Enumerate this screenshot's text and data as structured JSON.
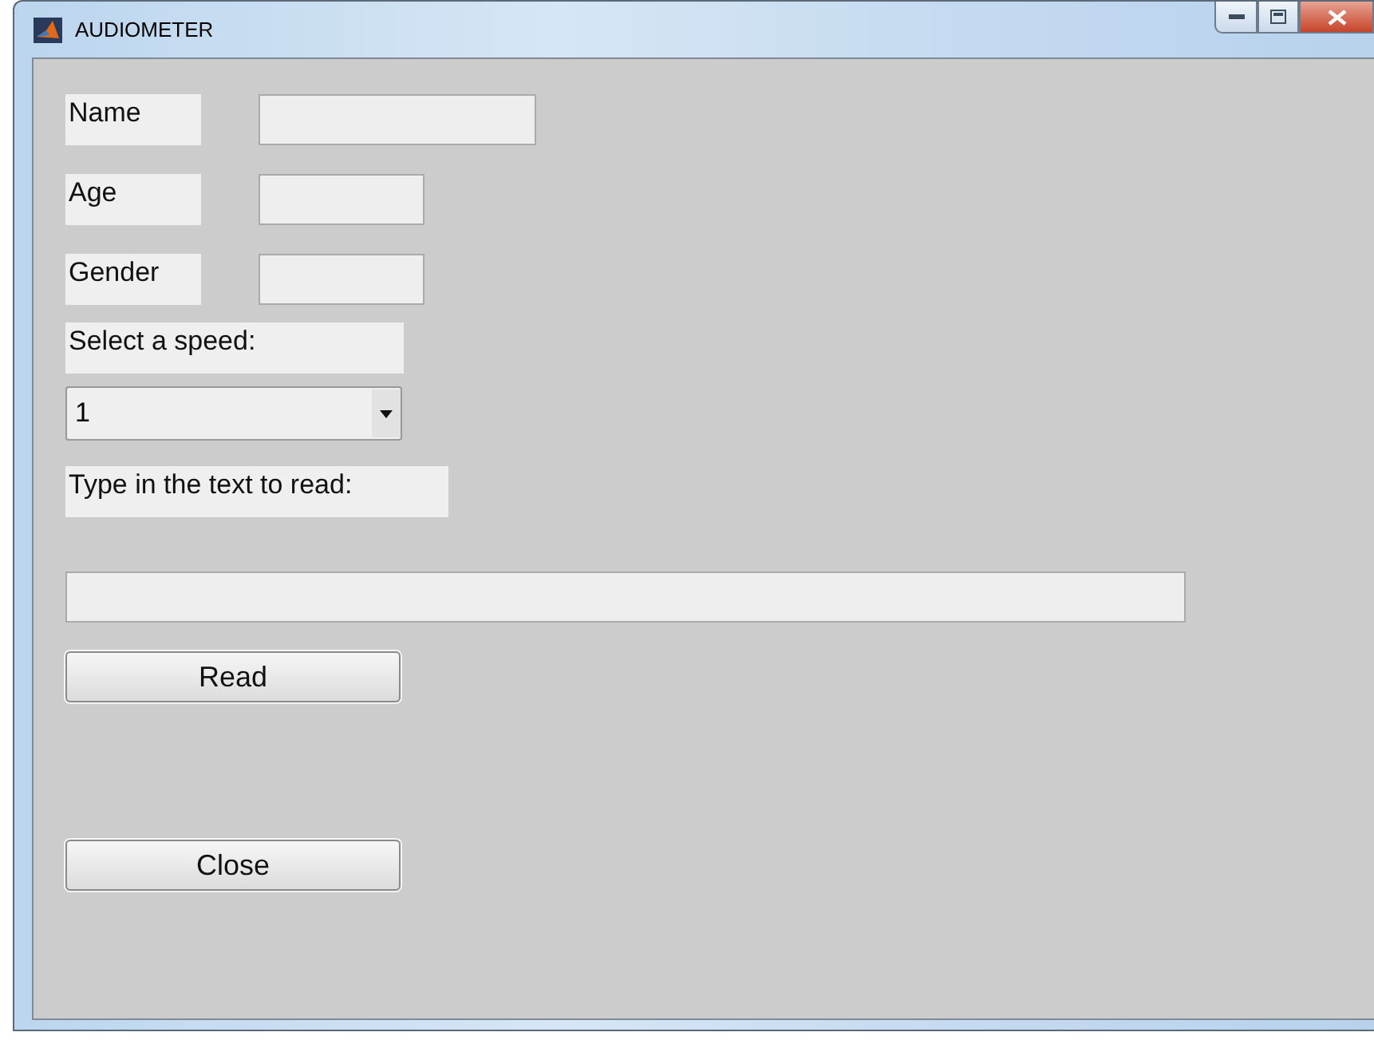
{
  "window": {
    "title": "AUDIOMETER"
  },
  "fields": [
    {
      "label": "Name"
    },
    {
      "label": "Age"
    },
    {
      "label": "Gender"
    }
  ],
  "speed": {
    "label": "Select a speed:",
    "value": "1"
  },
  "text_entry": {
    "label": "Type in the text to read:"
  },
  "buttons": [
    {
      "label": "Read"
    },
    {
      "label": "Close"
    }
  ]
}
